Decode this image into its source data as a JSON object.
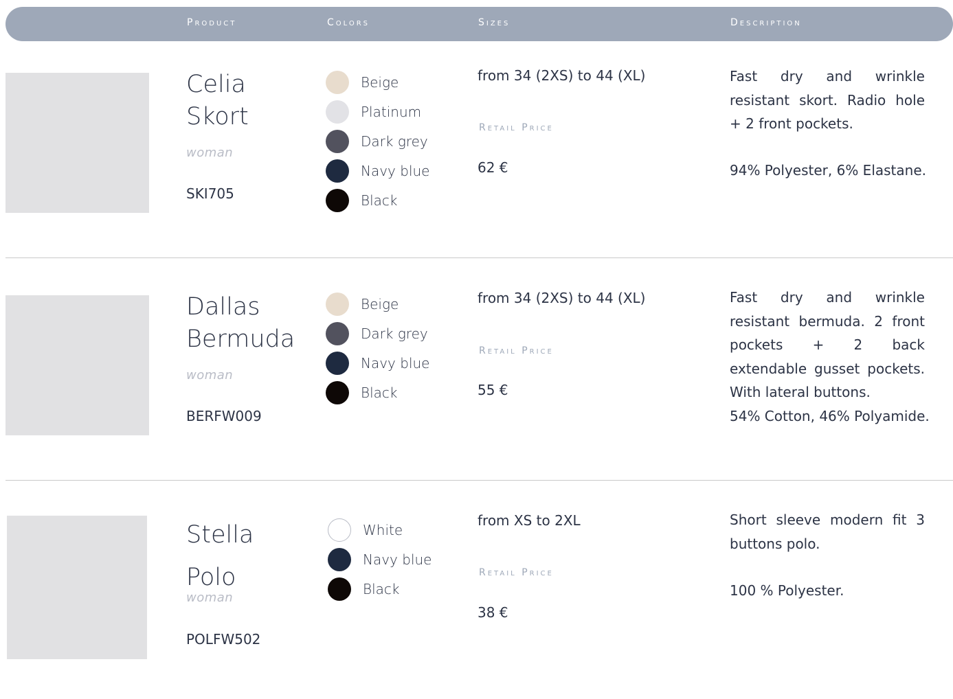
{
  "header": {
    "product": "Product",
    "colors": "Colors",
    "sizes": "Sizes",
    "description": "Description"
  },
  "retail_price_label": "Retail Price",
  "products": [
    {
      "name_line1": "Celia",
      "name_line2": "Skort",
      "gender": "woman",
      "code": "SKI705",
      "colors": [
        {
          "label": "Beige",
          "hex": "#e8dccd"
        },
        {
          "label": "Platinum",
          "hex": "#e2e2e6"
        },
        {
          "label": "Dark grey",
          "hex": "#52525e"
        },
        {
          "label": "Navy blue",
          "hex": "#1e2a40"
        },
        {
          "label": "Black",
          "hex": "#0e0806"
        }
      ],
      "sizes": "from 34 (2XS) to 44 (XL)",
      "price": "62 €",
      "description": "Fast dry and wrinkle resistant skort. Radio hole + 2 front pockets.",
      "composition": "94% Polyester, 6% Elastane."
    },
    {
      "name_line1": "Dallas",
      "name_line2": "Bermuda",
      "gender": "woman",
      "code": "BERFW009",
      "colors": [
        {
          "label": "Beige",
          "hex": "#e8dccd"
        },
        {
          "label": "Dark grey",
          "hex": "#52525e"
        },
        {
          "label": "Navy blue",
          "hex": "#1e2a40"
        },
        {
          "label": "Black",
          "hex": "#0e0806"
        }
      ],
      "sizes": "from 34 (2XS) to 44 (XL)",
      "price": "55 €",
      "description": "Fast dry and wrinkle resistant bermuda. 2 front pockets + 2 back extendable gusset pockets. With lateral buttons.",
      "composition": "54%  Cotton, 46% Polyamide."
    },
    {
      "name_line1": "Stella",
      "name_line2": "Polo",
      "gender": "woman",
      "code": "POLFW502",
      "colors": [
        {
          "label": "White",
          "hex": "#ffffff"
        },
        {
          "label": "Navy blue",
          "hex": "#1e2a40"
        },
        {
          "label": "Black",
          "hex": "#0e0806"
        }
      ],
      "sizes": "from XS to 2XL",
      "price": "38 €",
      "description": "Short sleeve modern fit 3 buttons polo.",
      "composition": "100 % Polyester."
    }
  ]
}
